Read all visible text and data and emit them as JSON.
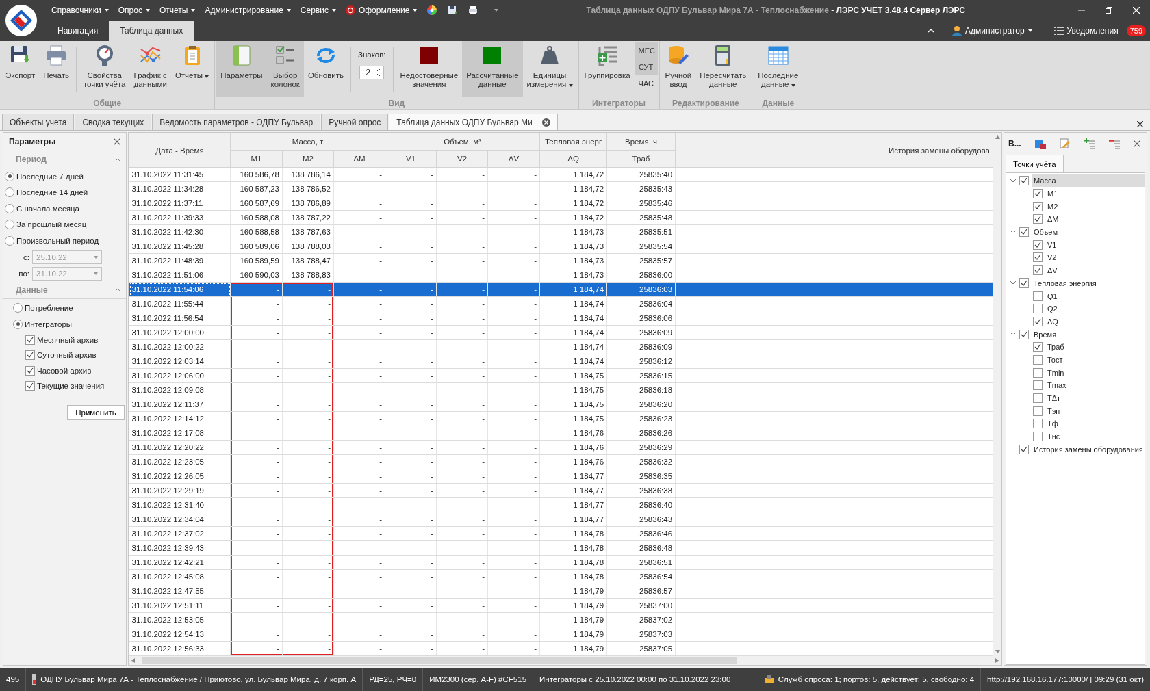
{
  "window": {
    "title_document": "Таблица данных ОДПУ Бульвар Мира 7А - Теплоснабжение",
    "title_app": " - ЛЭРС УЧЕТ 3.48.4 Сервер ЛЭРС"
  },
  "menu": [
    {
      "label": "Справочники",
      "kind": "plain"
    },
    {
      "label": "Опрос",
      "kind": "plain"
    },
    {
      "label": "Отчеты",
      "kind": "plain"
    },
    {
      "label": "Администрирование",
      "kind": "plain"
    },
    {
      "label": "Сервис",
      "kind": "plain"
    },
    {
      "label": "Оформление",
      "kind": "styled"
    }
  ],
  "app_tabs": [
    {
      "label": "Навигация",
      "selected": false
    },
    {
      "label": "Таблица данных",
      "selected": true
    }
  ],
  "user": {
    "name": "Администратор",
    "notifications_label": "Уведомления",
    "notifications_count": "759"
  },
  "ribbon": [
    {
      "label": "Общие",
      "items": [
        {
          "kind": "button",
          "label": "Экспорт",
          "pressed": false,
          "dropdown": false
        },
        {
          "kind": "button",
          "label": "Печать",
          "pressed": false,
          "dropdown": false
        },
        {
          "kind": "separator"
        },
        {
          "kind": "button",
          "label": "Свойства\nточки учёта",
          "pressed": false,
          "dropdown": false
        },
        {
          "kind": "button",
          "label": "График с\nданными",
          "pressed": false,
          "dropdown": false
        },
        {
          "kind": "button",
          "label": "Отчёты",
          "pressed": false,
          "dropdown": true
        }
      ]
    },
    {
      "label": "Вид",
      "items": [
        {
          "kind": "button",
          "label": "Параметры",
          "pressed": true,
          "dropdown": false
        },
        {
          "kind": "button",
          "label": "Выбор\nколонок",
          "pressed": true,
          "dropdown": false
        },
        {
          "kind": "button",
          "label": "Обновить",
          "pressed": false,
          "dropdown": false
        },
        {
          "kind": "separator"
        },
        {
          "kind": "spinner",
          "label": "Знаков:",
          "value": "2"
        },
        {
          "kind": "separator"
        },
        {
          "kind": "swatch",
          "label": "Недостоверные\nзначения",
          "pressed": false,
          "color": "#7f0000"
        },
        {
          "kind": "swatch",
          "label": "Рассчитанные\nданные",
          "pressed": true,
          "color": "#008000"
        },
        {
          "kind": "button",
          "label": "Единицы\nизмерения",
          "pressed": false,
          "dropdown": true
        }
      ]
    },
    {
      "label": "Интеграторы",
      "items": [
        {
          "kind": "button",
          "label": "Группировка",
          "pressed": false,
          "dropdown": false
        },
        {
          "kind": "toggles",
          "options": [
            {
              "label": "МЕС",
              "pressed": true
            },
            {
              "label": "СУТ",
              "pressed": true
            },
            {
              "label": "ЧАС",
              "pressed": false
            }
          ]
        }
      ]
    },
    {
      "label": "Редактирование",
      "items": [
        {
          "kind": "button",
          "label": "Ручной\nввод",
          "pressed": false,
          "dropdown": false
        },
        {
          "kind": "button",
          "label": "Пересчитать\nданные",
          "pressed": false,
          "dropdown": false
        }
      ]
    },
    {
      "label": "Данные",
      "items": [
        {
          "kind": "button",
          "label": "Последние\nданные",
          "pressed": false,
          "dropdown": true
        }
      ]
    }
  ],
  "doc_tabs": [
    {
      "label": "Объекты учета",
      "selected": false
    },
    {
      "label": "Сводка текущих",
      "selected": false
    },
    {
      "label": "Ведомость параметров - ОДПУ Бульвар",
      "selected": false
    },
    {
      "label": "Ручной опрос",
      "selected": false
    },
    {
      "label": "Таблица данных ОДПУ Бульвар Ми",
      "selected": true
    }
  ],
  "params_panel": {
    "title": "Параметры",
    "period": {
      "title": "Период",
      "options": [
        {
          "label": "Последние 7 дней",
          "selected": true
        },
        {
          "label": "Последние 14 дней",
          "selected": false
        },
        {
          "label": "С начала месяца",
          "selected": false
        },
        {
          "label": "За прошлый месяц",
          "selected": false
        },
        {
          "label": "Произвольный период",
          "selected": false
        }
      ],
      "from_label": "с:",
      "from_value": "25.10.22",
      "to_label": "по:",
      "to_value": "31.10.22"
    },
    "data": {
      "title": "Данные",
      "options": [
        {
          "label": "Потребление",
          "selected": false
        },
        {
          "label": "Интеграторы",
          "selected": true
        }
      ],
      "archives": [
        {
          "label": "Месячный архив",
          "checked": true
        },
        {
          "label": "Суточный архив",
          "checked": true
        },
        {
          "label": "Часовой архив",
          "checked": true
        },
        {
          "label": "Текущие значения",
          "checked": true
        }
      ]
    },
    "apply_button": "Применить"
  },
  "table": {
    "header_groups": [
      "Дата - Время",
      "Масса, т",
      "Объем, м³",
      "Тепловая энерг",
      "Время, ч",
      "История замены оборудова"
    ],
    "sub_headers": [
      "M1",
      "M2",
      "ΔM",
      "V1",
      "V2",
      "ΔV",
      "ΔQ",
      "Траб"
    ],
    "rows": [
      {
        "cells": [
          "31.10.2022 11:31:45",
          "160 586,78",
          "138 786,14",
          "-",
          "-",
          "-",
          "-",
          "1 184,72",
          "25835:40"
        ],
        "selected": false,
        "outlined": false
      },
      {
        "cells": [
          "31.10.2022 11:34:28",
          "160 587,23",
          "138 786,52",
          "-",
          "-",
          "-",
          "-",
          "1 184,72",
          "25835:43"
        ],
        "selected": false,
        "outlined": false
      },
      {
        "cells": [
          "31.10.2022 11:37:11",
          "160 587,69",
          "138 786,89",
          "-",
          "-",
          "-",
          "-",
          "1 184,72",
          "25835:46"
        ],
        "selected": false,
        "outlined": false
      },
      {
        "cells": [
          "31.10.2022 11:39:33",
          "160 588,08",
          "138 787,22",
          "-",
          "-",
          "-",
          "-",
          "1 184,72",
          "25835:48"
        ],
        "selected": false,
        "outlined": false
      },
      {
        "cells": [
          "31.10.2022 11:42:30",
          "160 588,58",
          "138 787,63",
          "-",
          "-",
          "-",
          "-",
          "1 184,73",
          "25835:51"
        ],
        "selected": false,
        "outlined": false
      },
      {
        "cells": [
          "31.10.2022 11:45:28",
          "160 589,06",
          "138 788,03",
          "-",
          "-",
          "-",
          "-",
          "1 184,73",
          "25835:54"
        ],
        "selected": false,
        "outlined": false
      },
      {
        "cells": [
          "31.10.2022 11:48:39",
          "160 589,59",
          "138 788,47",
          "-",
          "-",
          "-",
          "-",
          "1 184,73",
          "25835:57"
        ],
        "selected": false,
        "outlined": false
      },
      {
        "cells": [
          "31.10.2022 11:51:06",
          "160 590,03",
          "138 788,83",
          "-",
          "-",
          "-",
          "-",
          "1 184,73",
          "25836:00"
        ],
        "selected": false,
        "outlined": false
      },
      {
        "cells": [
          "31.10.2022 11:54:06",
          "-",
          "-",
          "-",
          "-",
          "-",
          "-",
          "1 184,74",
          "25836:03"
        ],
        "selected": true,
        "outlined": true
      },
      {
        "cells": [
          "31.10.2022 11:55:44",
          "-",
          "-",
          "-",
          "-",
          "-",
          "-",
          "1 184,74",
          "25836:04"
        ],
        "selected": false,
        "outlined": true
      },
      {
        "cells": [
          "31.10.2022 11:56:54",
          "-",
          "-",
          "-",
          "-",
          "-",
          "-",
          "1 184,74",
          "25836:06"
        ],
        "selected": false,
        "outlined": true
      },
      {
        "cells": [
          "31.10.2022 12:00:00",
          "-",
          "-",
          "-",
          "-",
          "-",
          "-",
          "1 184,74",
          "25836:09"
        ],
        "selected": false,
        "outlined": true
      },
      {
        "cells": [
          "31.10.2022 12:00:22",
          "-",
          "-",
          "-",
          "-",
          "-",
          "-",
          "1 184,74",
          "25836:09"
        ],
        "selected": false,
        "outlined": true
      },
      {
        "cells": [
          "31.10.2022 12:03:14",
          "-",
          "-",
          "-",
          "-",
          "-",
          "-",
          "1 184,74",
          "25836:12"
        ],
        "selected": false,
        "outlined": true
      },
      {
        "cells": [
          "31.10.2022 12:06:00",
          "-",
          "-",
          "-",
          "-",
          "-",
          "-",
          "1 184,75",
          "25836:15"
        ],
        "selected": false,
        "outlined": true
      },
      {
        "cells": [
          "31.10.2022 12:09:08",
          "-",
          "-",
          "-",
          "-",
          "-",
          "-",
          "1 184,75",
          "25836:18"
        ],
        "selected": false,
        "outlined": true
      },
      {
        "cells": [
          "31.10.2022 12:11:37",
          "-",
          "-",
          "-",
          "-",
          "-",
          "-",
          "1 184,75",
          "25836:20"
        ],
        "selected": false,
        "outlined": true
      },
      {
        "cells": [
          "31.10.2022 12:14:12",
          "-",
          "-",
          "-",
          "-",
          "-",
          "-",
          "1 184,75",
          "25836:23"
        ],
        "selected": false,
        "outlined": true
      },
      {
        "cells": [
          "31.10.2022 12:17:08",
          "-",
          "-",
          "-",
          "-",
          "-",
          "-",
          "1 184,76",
          "25836:26"
        ],
        "selected": false,
        "outlined": true
      },
      {
        "cells": [
          "31.10.2022 12:20:22",
          "-",
          "-",
          "-",
          "-",
          "-",
          "-",
          "1 184,76",
          "25836:29"
        ],
        "selected": false,
        "outlined": true
      },
      {
        "cells": [
          "31.10.2022 12:23:05",
          "-",
          "-",
          "-",
          "-",
          "-",
          "-",
          "1 184,76",
          "25836:32"
        ],
        "selected": false,
        "outlined": true
      },
      {
        "cells": [
          "31.10.2022 12:26:05",
          "-",
          "-",
          "-",
          "-",
          "-",
          "-",
          "1 184,77",
          "25836:35"
        ],
        "selected": false,
        "outlined": true
      },
      {
        "cells": [
          "31.10.2022 12:29:19",
          "-",
          "-",
          "-",
          "-",
          "-",
          "-",
          "1 184,77",
          "25836:38"
        ],
        "selected": false,
        "outlined": true
      },
      {
        "cells": [
          "31.10.2022 12:31:40",
          "-",
          "-",
          "-",
          "-",
          "-",
          "-",
          "1 184,77",
          "25836:40"
        ],
        "selected": false,
        "outlined": true
      },
      {
        "cells": [
          "31.10.2022 12:34:04",
          "-",
          "-",
          "-",
          "-",
          "-",
          "-",
          "1 184,77",
          "25836:43"
        ],
        "selected": false,
        "outlined": true
      },
      {
        "cells": [
          "31.10.2022 12:37:02",
          "-",
          "-",
          "-",
          "-",
          "-",
          "-",
          "1 184,78",
          "25836:46"
        ],
        "selected": false,
        "outlined": true
      },
      {
        "cells": [
          "31.10.2022 12:39:43",
          "-",
          "-",
          "-",
          "-",
          "-",
          "-",
          "1 184,78",
          "25836:48"
        ],
        "selected": false,
        "outlined": true
      },
      {
        "cells": [
          "31.10.2022 12:42:21",
          "-",
          "-",
          "-",
          "-",
          "-",
          "-",
          "1 184,78",
          "25836:51"
        ],
        "selected": false,
        "outlined": true
      },
      {
        "cells": [
          "31.10.2022 12:45:08",
          "-",
          "-",
          "-",
          "-",
          "-",
          "-",
          "1 184,78",
          "25836:54"
        ],
        "selected": false,
        "outlined": true
      },
      {
        "cells": [
          "31.10.2022 12:47:55",
          "-",
          "-",
          "-",
          "-",
          "-",
          "-",
          "1 184,79",
          "25836:57"
        ],
        "selected": false,
        "outlined": true
      },
      {
        "cells": [
          "31.10.2022 12:51:11",
          "-",
          "-",
          "-",
          "-",
          "-",
          "-",
          "1 184,79",
          "25837:00"
        ],
        "selected": false,
        "outlined": true
      },
      {
        "cells": [
          "31.10.2022 12:53:05",
          "-",
          "-",
          "-",
          "-",
          "-",
          "-",
          "1 184,79",
          "25837:02"
        ],
        "selected": false,
        "outlined": true
      },
      {
        "cells": [
          "31.10.2022 12:54:13",
          "-",
          "-",
          "-",
          "-",
          "-",
          "-",
          "1 184,79",
          "25837:03"
        ],
        "selected": false,
        "outlined": true
      },
      {
        "cells": [
          "31.10.2022 12:56:33",
          "-",
          "-",
          "-",
          "-",
          "-",
          "-",
          "1 184,79",
          "25837:05"
        ],
        "selected": false,
        "outlined": true
      }
    ]
  },
  "columns_panel": {
    "title": "В...",
    "tab": "Точки учёта",
    "tree": [
      {
        "label": "Масса",
        "checked": true,
        "selected": true,
        "expanded": true,
        "children": [
          {
            "label": "M1",
            "checked": true
          },
          {
            "label": "M2",
            "checked": true
          },
          {
            "label": "ΔM",
            "checked": true
          }
        ]
      },
      {
        "label": "Объем",
        "checked": true,
        "selected": false,
        "expanded": true,
        "children": [
          {
            "label": "V1",
            "checked": true
          },
          {
            "label": "V2",
            "checked": true
          },
          {
            "label": "ΔV",
            "checked": true
          }
        ]
      },
      {
        "label": "Тепловая энергия",
        "checked": true,
        "selected": false,
        "expanded": true,
        "children": [
          {
            "label": "Q1",
            "checked": false
          },
          {
            "label": "Q2",
            "checked": false
          },
          {
            "label": "ΔQ",
            "checked": true
          }
        ]
      },
      {
        "label": "Время",
        "checked": true,
        "selected": false,
        "expanded": true,
        "children": [
          {
            "label": "Траб",
            "checked": true
          },
          {
            "label": "Тост",
            "checked": false
          },
          {
            "label": "Tmin",
            "checked": false
          },
          {
            "label": "Tmax",
            "checked": false
          },
          {
            "label": "TΔт",
            "checked": false
          },
          {
            "label": "Тэп",
            "checked": false
          },
          {
            "label": "Тф",
            "checked": false
          },
          {
            "label": "Тнс",
            "checked": false
          }
        ]
      },
      {
        "label": "История замены оборудования",
        "checked": true,
        "selected": false,
        "expanded": false
      }
    ]
  },
  "status_bar": [
    {
      "text": "495",
      "kind": "text"
    },
    {
      "text": "ОДПУ Бульвар Мира 7А - Теплоснабжение / Приютово, ул. Бульвар Мира, д. 7 корп. А",
      "kind": "device"
    },
    {
      "text": "РД=25, РЧ=0",
      "kind": "text"
    },
    {
      "text": "ИМ2300 (сер. А-F) #CF515",
      "kind": "text"
    },
    {
      "text": "Интеграторы с 25.10.2022 00:00 по 31.10.2022 23:00",
      "kind": "text"
    },
    {
      "text": "Служб опроса: 1; портов: 5, действует: 5, свободно: 4",
      "kind": "service"
    },
    {
      "text": "http://192.168.16.177:10000/ | 09:29 (31 окт)",
      "kind": "text"
    }
  ]
}
